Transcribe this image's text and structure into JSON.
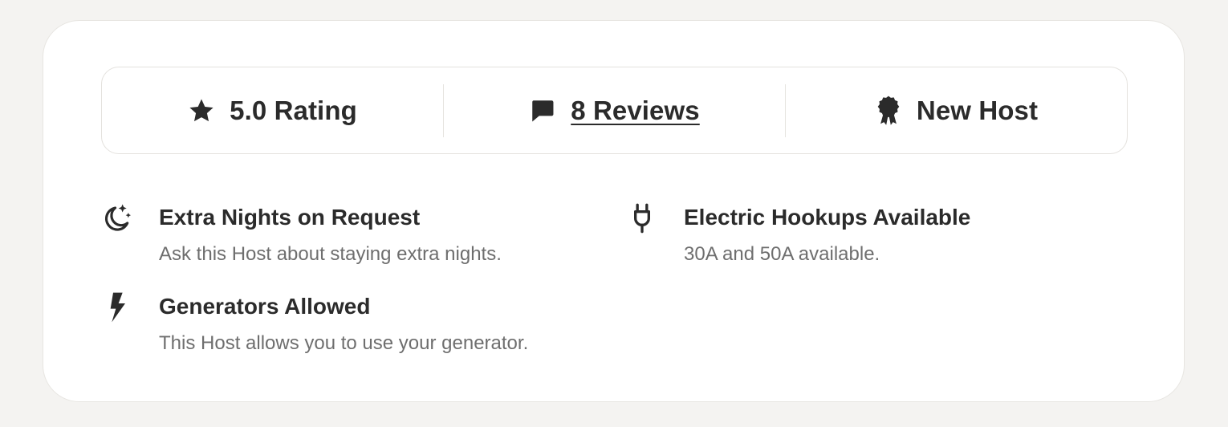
{
  "stats": {
    "rating": {
      "label": "5.0 Rating",
      "icon": "star-icon"
    },
    "reviews": {
      "label": "8 Reviews",
      "icon": "chat-bubble-icon"
    },
    "host": {
      "label": "New Host",
      "icon": "badge-icon"
    }
  },
  "features": [
    {
      "title": "Extra Nights on Request",
      "description": "Ask this Host about staying extra nights.",
      "icon": "moon-stars-icon"
    },
    {
      "title": "Electric Hookups Available",
      "description": "30A and 50A available.",
      "icon": "plug-icon"
    },
    {
      "title": "Generators Allowed",
      "description": "This Host allows you to use your generator.",
      "icon": "lightning-icon"
    }
  ],
  "colors": {
    "text": "#2b2b2b",
    "muted": "#6e6e6e",
    "border": "#e4e2de",
    "background": "#f4f3f1"
  }
}
